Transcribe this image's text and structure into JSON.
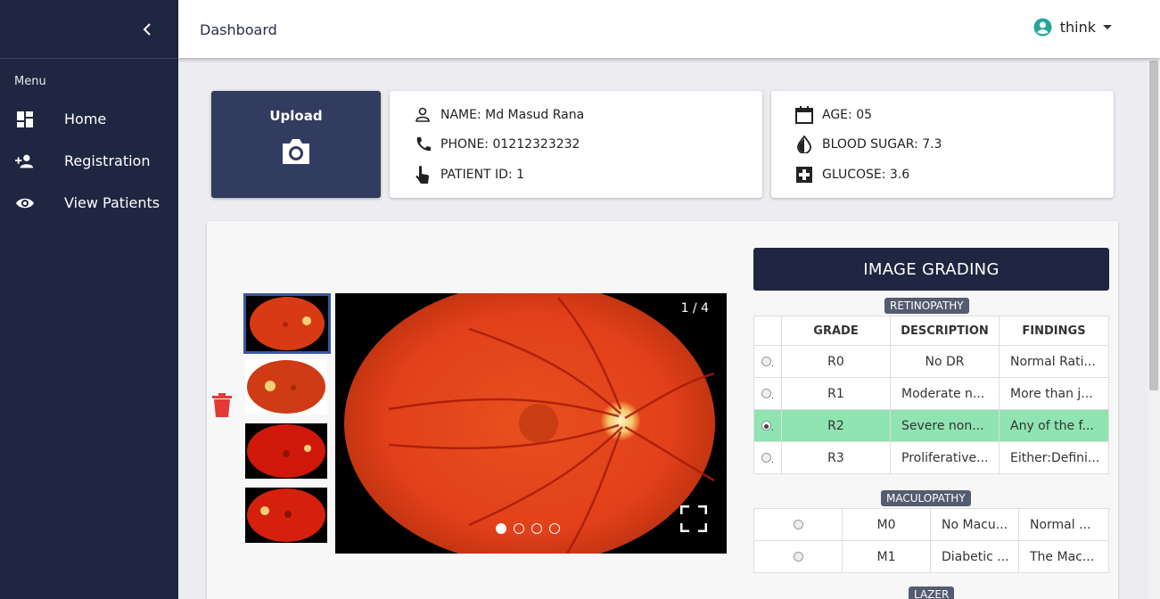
{
  "topbar": {
    "title": "Dashboard",
    "user": "think"
  },
  "sidebar": {
    "menu_label": "Menu",
    "items": [
      {
        "label": "Home",
        "icon": "dashboard-icon"
      },
      {
        "label": "Registration",
        "icon": "person-add-icon"
      },
      {
        "label": "View Patients",
        "icon": "eye-icon"
      }
    ]
  },
  "upload": {
    "label": "Upload"
  },
  "patient": {
    "name": "NAME: Md Masud Rana",
    "phone": "PHONE: 01212323232",
    "id": "PATIENT ID: 1",
    "age": "AGE: 05",
    "blood_sugar": "BLOOD SUGAR: 7.3",
    "glucose": "GLUCOSE: 3.6"
  },
  "viewer": {
    "counter": "1 / 4"
  },
  "grading": {
    "title": "IMAGE GRADING",
    "retinopathy_label": "RETINOPATHY",
    "columns": [
      "GRADE",
      "DESCRIPTION",
      "FINDINGS"
    ],
    "retinopathy": [
      {
        "grade": "R0",
        "description": "No DR",
        "findings": "Normal Rati..."
      },
      {
        "grade": "R1",
        "description": "Moderate n...",
        "findings": "More than j..."
      },
      {
        "grade": "R2",
        "description": "Severe non...",
        "findings": "Any of the f..."
      },
      {
        "grade": "R3",
        "description": "Proliferative...",
        "findings": "Either:Defini..."
      }
    ],
    "maculopathy_label": "MACULOPATHY",
    "maculopathy": [
      {
        "grade": "M0",
        "description": "No Macu...",
        "findings": "Normal ..."
      },
      {
        "grade": "M1",
        "description": "Diabetic ...",
        "findings": "The Mac..."
      }
    ],
    "lazer_label": "LAZER"
  },
  "colors": {
    "sidebar": "#1f2641",
    "upload_card": "#323b60",
    "selected_row": "#8fe4b2",
    "trash": "#e53935",
    "avatar": "#26a69a"
  }
}
